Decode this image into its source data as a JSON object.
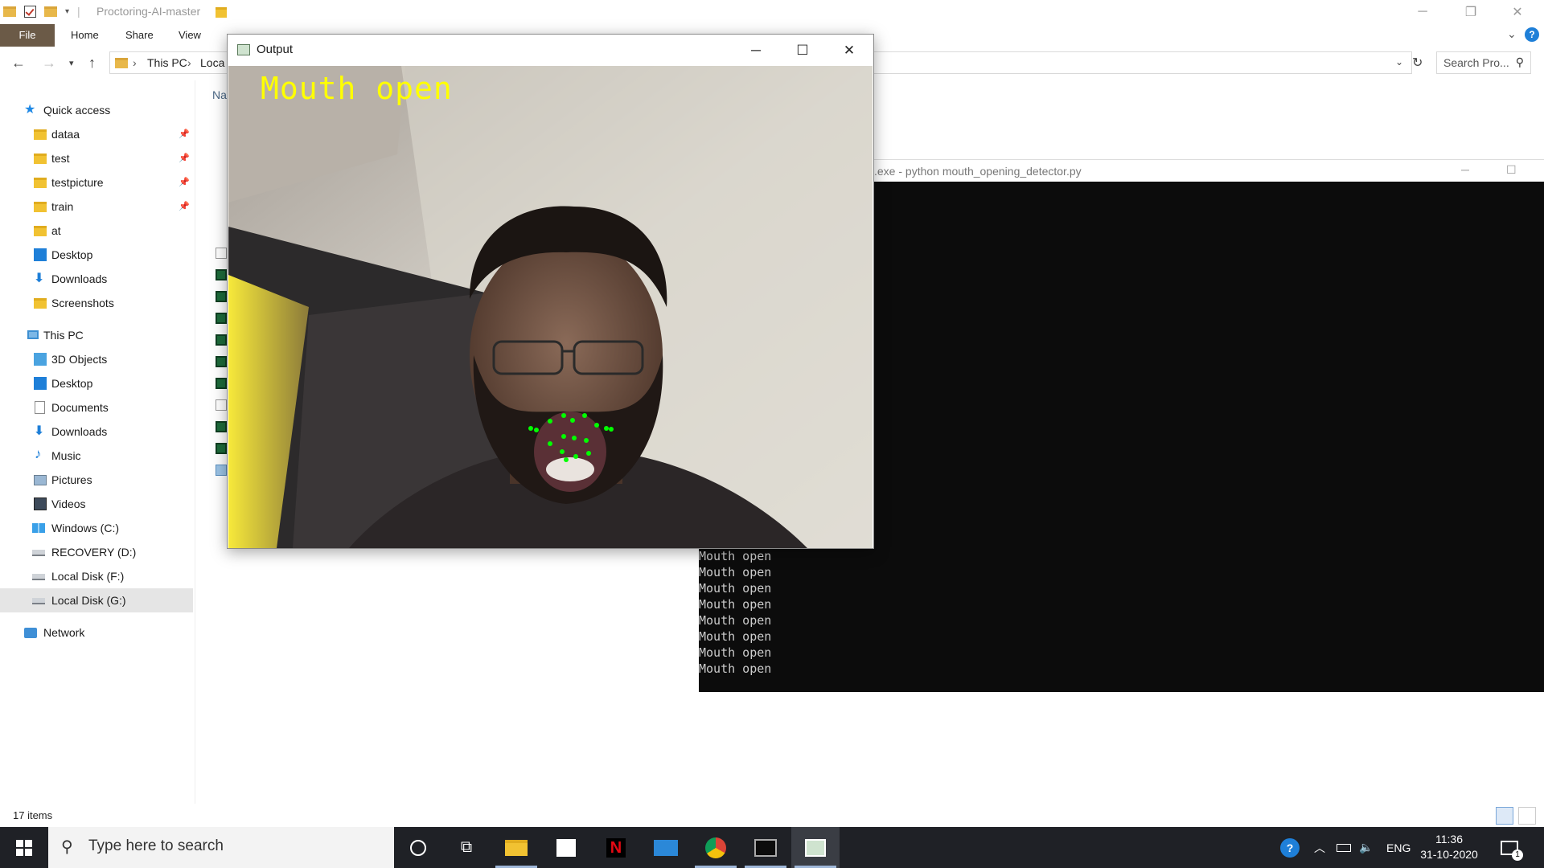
{
  "explorer": {
    "title": "Proctoring-AI-master",
    "ribbon_tabs": [
      "File",
      "Home",
      "Share",
      "View"
    ],
    "breadcrumb": [
      "This PC",
      "Loca"
    ],
    "search_placeholder": "Search Pro...",
    "column_header": "Na",
    "status": "17 items",
    "nav": {
      "quick_access": "Quick access",
      "pinned": [
        "dataa",
        "test",
        "testpicture",
        "train"
      ],
      "recent": [
        "at"
      ],
      "qa_desktop": "Desktop",
      "qa_downloads": "Downloads",
      "qa_screenshots": "Screenshots",
      "this_pc": "This PC",
      "pc_items": [
        "3D Objects",
        "Desktop",
        "Documents",
        "Downloads",
        "Music",
        "Pictures",
        "Videos",
        "Windows (C:)",
        "RECOVERY (D:)",
        "Local Disk (F:)",
        "Local Disk (G:)"
      ],
      "network": "Network"
    }
  },
  "console": {
    "title": ".exe - python  mouth_opening_detector.py",
    "lines": [
      "Mouth open",
      "Mouth open",
      "Mouth open",
      "Mouth open",
      "Mouth open",
      "Mouth open",
      "Mouth open",
      "Mouth open"
    ]
  },
  "output_window": {
    "title": "Output",
    "overlay_text": "Mouth open"
  },
  "taskbar": {
    "search_placeholder": "Type here to search",
    "language": "ENG",
    "time": "11:36",
    "date": "31-10-2020",
    "notification_count": "1"
  },
  "colors": {
    "overlay_text": "#ffff00",
    "landmarks": "#00ff00",
    "file_tab": "#6b5a47",
    "console_bg": "#0c0c0c",
    "taskbar_bg": "#1f2126"
  }
}
